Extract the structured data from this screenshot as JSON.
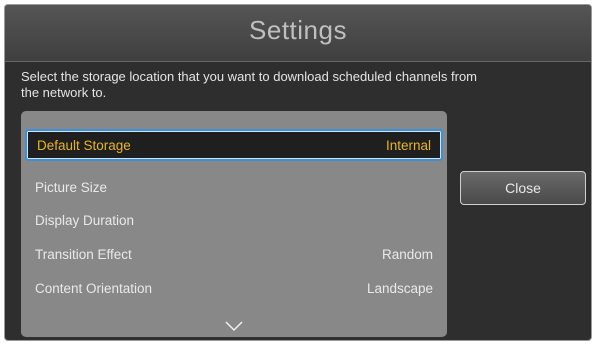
{
  "header": {
    "title": "Settings"
  },
  "description": "Select the storage location that you want to download scheduled channels from the network to.",
  "menu": {
    "items": [
      {
        "label": "Default Storage",
        "value": "Internal",
        "selected": true
      },
      {
        "label": "Picture Size",
        "value": ""
      },
      {
        "label": "Display Duration",
        "value": ""
      },
      {
        "label": "Transition Effect",
        "value": "Random"
      },
      {
        "label": "Content Orientation",
        "value": "Landscape"
      }
    ],
    "scroll_icon": "chevron-down-icon"
  },
  "buttons": {
    "close_label": "Close"
  },
  "colors": {
    "selected_text": "#e8b427",
    "selection_border": "#3d8fd6"
  }
}
